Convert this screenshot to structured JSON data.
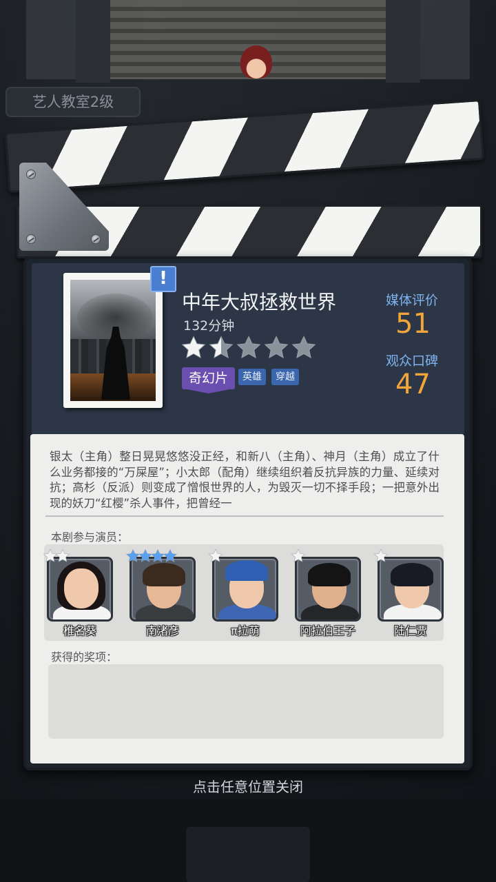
{
  "background": {
    "level_badge": "艺人教室2级"
  },
  "movie": {
    "title": "中年大叔拯救世界",
    "duration": "132分钟",
    "rating_stars": 1.5,
    "rating_max": 5,
    "genre_main": "奇幻片",
    "tags": [
      "英雄",
      "穿越"
    ],
    "alert_icon": "exclamation-icon"
  },
  "ratings": {
    "media_label": "媒体评价",
    "media_value": "51",
    "audience_label": "观众口碑",
    "audience_value": "47"
  },
  "synopsis": "银太（主角）整日晃晃悠悠没正经，和新八（主角）、神月（主角）成立了什么业务都接的“万屎屋”；小太郎（配角）继续组织着反抗异族的力量、延续对抗；高杉（反派）则变成了憎恨世界的人，为毁灭一切不择手段；一把意外出现的妖刀“红樱”杀人事件，把曾经一",
  "cast": {
    "label": "本剧参与演员：",
    "actors": [
      {
        "name": "椎名葵",
        "stars": 2
      },
      {
        "name": "南渚彦",
        "stars": 4
      },
      {
        "name": "π拉萌",
        "stars": 1
      },
      {
        "name": "阿拉伯王子",
        "stars": 1
      },
      {
        "name": "陆仁贾",
        "stars": 1
      }
    ]
  },
  "awards": {
    "label": "获得的奖项："
  },
  "close_hint": "点击任意位置关闭",
  "colors": {
    "accent_orange": "#f2a53a",
    "label_blue": "#7fb3ee",
    "genre_purple": "#6a4fb0",
    "tag_blue": "#3a66ae",
    "star_blue": "#5aa0f0"
  }
}
